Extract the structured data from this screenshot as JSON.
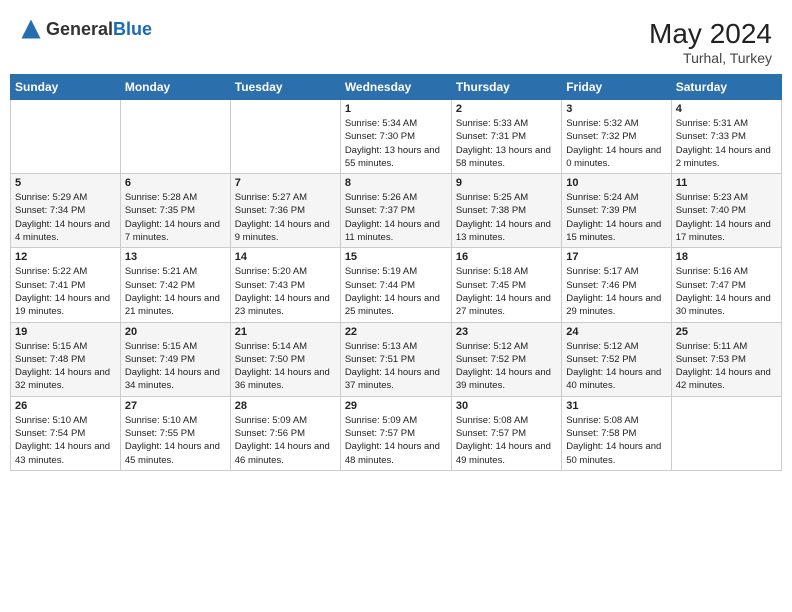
{
  "header": {
    "logo_general": "General",
    "logo_blue": "Blue",
    "month_year": "May 2024",
    "location": "Turhal, Turkey"
  },
  "weekdays": [
    "Sunday",
    "Monday",
    "Tuesday",
    "Wednesday",
    "Thursday",
    "Friday",
    "Saturday"
  ],
  "weeks": [
    [
      {
        "day": "",
        "info": ""
      },
      {
        "day": "",
        "info": ""
      },
      {
        "day": "",
        "info": ""
      },
      {
        "day": "1",
        "info": "Sunrise: 5:34 AM\nSunset: 7:30 PM\nDaylight: 13 hours and 55 minutes."
      },
      {
        "day": "2",
        "info": "Sunrise: 5:33 AM\nSunset: 7:31 PM\nDaylight: 13 hours and 58 minutes."
      },
      {
        "day": "3",
        "info": "Sunrise: 5:32 AM\nSunset: 7:32 PM\nDaylight: 14 hours and 0 minutes."
      },
      {
        "day": "4",
        "info": "Sunrise: 5:31 AM\nSunset: 7:33 PM\nDaylight: 14 hours and 2 minutes."
      }
    ],
    [
      {
        "day": "5",
        "info": "Sunrise: 5:29 AM\nSunset: 7:34 PM\nDaylight: 14 hours and 4 minutes."
      },
      {
        "day": "6",
        "info": "Sunrise: 5:28 AM\nSunset: 7:35 PM\nDaylight: 14 hours and 7 minutes."
      },
      {
        "day": "7",
        "info": "Sunrise: 5:27 AM\nSunset: 7:36 PM\nDaylight: 14 hours and 9 minutes."
      },
      {
        "day": "8",
        "info": "Sunrise: 5:26 AM\nSunset: 7:37 PM\nDaylight: 14 hours and 11 minutes."
      },
      {
        "day": "9",
        "info": "Sunrise: 5:25 AM\nSunset: 7:38 PM\nDaylight: 14 hours and 13 minutes."
      },
      {
        "day": "10",
        "info": "Sunrise: 5:24 AM\nSunset: 7:39 PM\nDaylight: 14 hours and 15 minutes."
      },
      {
        "day": "11",
        "info": "Sunrise: 5:23 AM\nSunset: 7:40 PM\nDaylight: 14 hours and 17 minutes."
      }
    ],
    [
      {
        "day": "12",
        "info": "Sunrise: 5:22 AM\nSunset: 7:41 PM\nDaylight: 14 hours and 19 minutes."
      },
      {
        "day": "13",
        "info": "Sunrise: 5:21 AM\nSunset: 7:42 PM\nDaylight: 14 hours and 21 minutes."
      },
      {
        "day": "14",
        "info": "Sunrise: 5:20 AM\nSunset: 7:43 PM\nDaylight: 14 hours and 23 minutes."
      },
      {
        "day": "15",
        "info": "Sunrise: 5:19 AM\nSunset: 7:44 PM\nDaylight: 14 hours and 25 minutes."
      },
      {
        "day": "16",
        "info": "Sunrise: 5:18 AM\nSunset: 7:45 PM\nDaylight: 14 hours and 27 minutes."
      },
      {
        "day": "17",
        "info": "Sunrise: 5:17 AM\nSunset: 7:46 PM\nDaylight: 14 hours and 29 minutes."
      },
      {
        "day": "18",
        "info": "Sunrise: 5:16 AM\nSunset: 7:47 PM\nDaylight: 14 hours and 30 minutes."
      }
    ],
    [
      {
        "day": "19",
        "info": "Sunrise: 5:15 AM\nSunset: 7:48 PM\nDaylight: 14 hours and 32 minutes."
      },
      {
        "day": "20",
        "info": "Sunrise: 5:15 AM\nSunset: 7:49 PM\nDaylight: 14 hours and 34 minutes."
      },
      {
        "day": "21",
        "info": "Sunrise: 5:14 AM\nSunset: 7:50 PM\nDaylight: 14 hours and 36 minutes."
      },
      {
        "day": "22",
        "info": "Sunrise: 5:13 AM\nSunset: 7:51 PM\nDaylight: 14 hours and 37 minutes."
      },
      {
        "day": "23",
        "info": "Sunrise: 5:12 AM\nSunset: 7:52 PM\nDaylight: 14 hours and 39 minutes."
      },
      {
        "day": "24",
        "info": "Sunrise: 5:12 AM\nSunset: 7:52 PM\nDaylight: 14 hours and 40 minutes."
      },
      {
        "day": "25",
        "info": "Sunrise: 5:11 AM\nSunset: 7:53 PM\nDaylight: 14 hours and 42 minutes."
      }
    ],
    [
      {
        "day": "26",
        "info": "Sunrise: 5:10 AM\nSunset: 7:54 PM\nDaylight: 14 hours and 43 minutes."
      },
      {
        "day": "27",
        "info": "Sunrise: 5:10 AM\nSunset: 7:55 PM\nDaylight: 14 hours and 45 minutes."
      },
      {
        "day": "28",
        "info": "Sunrise: 5:09 AM\nSunset: 7:56 PM\nDaylight: 14 hours and 46 minutes."
      },
      {
        "day": "29",
        "info": "Sunrise: 5:09 AM\nSunset: 7:57 PM\nDaylight: 14 hours and 48 minutes."
      },
      {
        "day": "30",
        "info": "Sunrise: 5:08 AM\nSunset: 7:57 PM\nDaylight: 14 hours and 49 minutes."
      },
      {
        "day": "31",
        "info": "Sunrise: 5:08 AM\nSunset: 7:58 PM\nDaylight: 14 hours and 50 minutes."
      },
      {
        "day": "",
        "info": ""
      }
    ]
  ]
}
